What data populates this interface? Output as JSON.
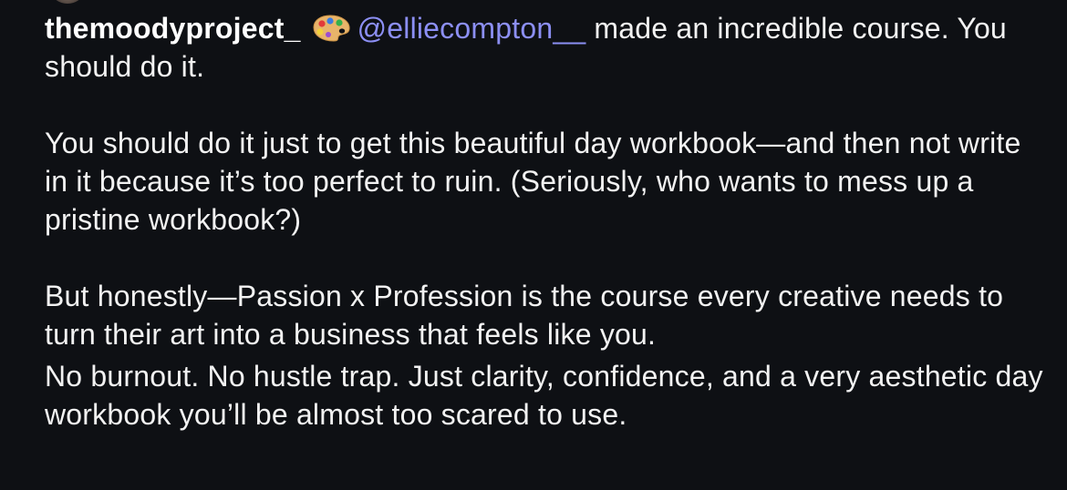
{
  "post": {
    "username": "themoodyproject_",
    "emoji_icon": "artist-palette-icon",
    "mention": "@elliecompton__",
    "line1_rest": " made an incredible course. You should do it.",
    "paragraph2": "You should do it just to get this beautiful day workbook—and then not write in it because it’s too perfect to ruin. (Seriously, who wants to mess up a pristine workbook?)",
    "paragraph3": "But honestly—Passion x Profession is the course every creative needs to turn their art into a business that feels like you.",
    "paragraph4": "No burnout. No hustle trap. Just clarity, confidence, and a very aesthetic day workbook you’ll be almost too scared to use."
  },
  "colors": {
    "background": "#0e1014",
    "text": "#f2f2f2",
    "mention": "#8c8ff4"
  }
}
